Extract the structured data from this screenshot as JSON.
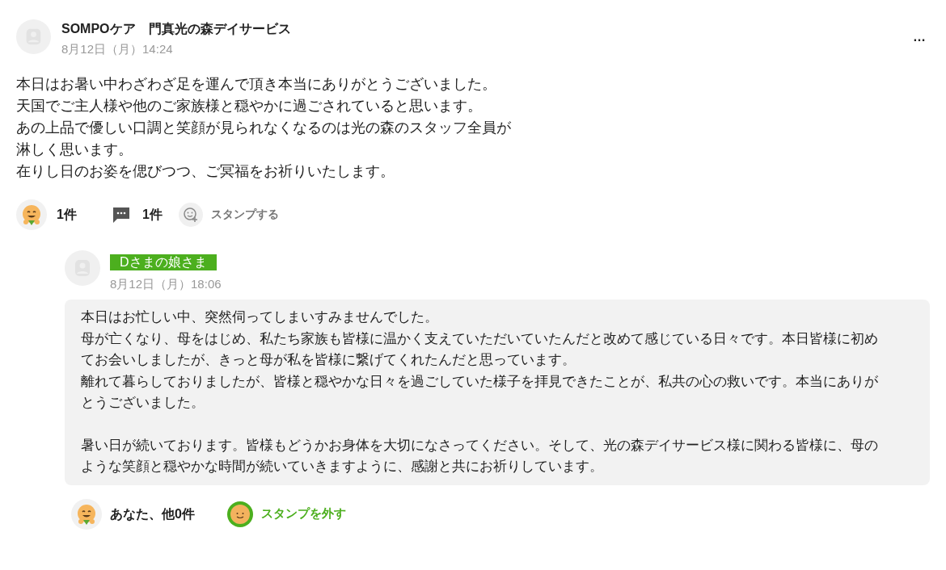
{
  "post": {
    "author": "SOMPOケア　門真光の森デイサービス",
    "author_highlighted": false,
    "date": "8月12日（月）14:24",
    "more": "…",
    "body": [
      "本日はお暑い中わざわざ足を運んで頂き本当にありがとうございました。",
      "天国でご主人様や他のご家族様と穏やかに過ごされていると思います。",
      "あの上品で優しい口調と笑顔が見られなくなるのは光の森のスタッフ全員が",
      "淋しく思います。",
      "在りし日のお姿を偲びつつ、ご冥福をお祈りいたします。"
    ],
    "reaction_count": "1件",
    "comment_count": "1件",
    "stamp_label": "スタンプする",
    "stamped": false
  },
  "reply": {
    "author": "Dさまの娘さま",
    "author_highlighted": true,
    "date": "8月12日（月）18:06",
    "body": [
      "本日はお忙しい中、突然伺ってしまいすみませんでした。",
      "母が亡くなり、母をはじめ、私たち家族も皆様に温かく支えていただいていたんだと改めて感じている日々です。本日皆様に初めてお会いしましたが、きっと母が私を皆様に繋げてくれたんだと思っています。",
      "離れて暮らしておりましたが、皆様と穏やかな日々を過ごしていた様子を拝見できたことが、私共の心の救いです。本当にありがとうございました。",
      "暑い日が続いております。皆様もどうかお身体を大切になさってください。そして、光の森デイサービス様に関わる皆様に、母のような笑顔と穏やかな時間が続いていきますように、感謝と共にお祈りしています。"
    ],
    "reaction_count": "あなた、他0件",
    "stamp_label": "スタンプを外す",
    "stamped": true
  }
}
